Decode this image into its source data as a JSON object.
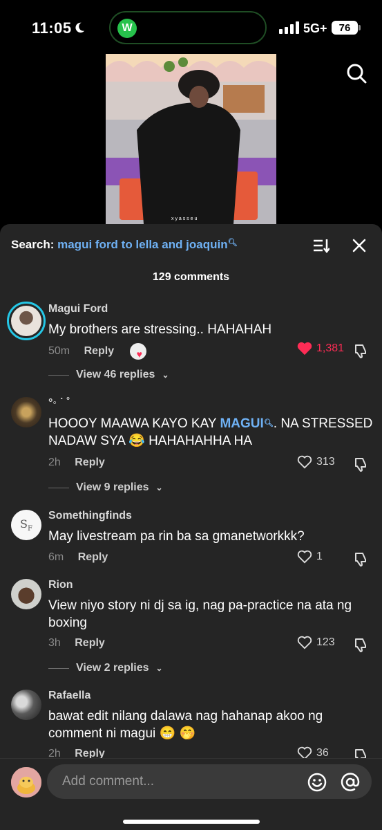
{
  "status_bar": {
    "time": "11:05",
    "network": "5G+",
    "battery": "76",
    "app_badge": "W"
  },
  "video": {
    "watermark": "x y a s s e u"
  },
  "sheet": {
    "search_label": "Search:",
    "search_query": "magui ford to lella and joaquin",
    "comment_count": "129 comments",
    "comments": [
      {
        "author": "Magui Ford",
        "text": "My brothers are stressing.. HAHAHAH",
        "time": "50m",
        "reply_label": "Reply",
        "likes": "1,381",
        "liked": true,
        "view_replies": "View 46 replies"
      },
      {
        "author": "°◦ ˙ ˚",
        "text_before": "HOOOY MAAWA KAYO KAY ",
        "mention": "MAGUI",
        "text_after": ". NA STRESSED NADAW SYA 😂 HAHAHAHHA HA",
        "time": "2h",
        "reply_label": "Reply",
        "likes": "313",
        "view_replies": "View 9 replies"
      },
      {
        "author": "Somethingfinds",
        "text": "May livestream pa rin ba sa gmanetworkkk?",
        "time": "6m",
        "reply_label": "Reply",
        "likes": "1"
      },
      {
        "author": "Rion",
        "text": "View niyo story ni dj sa ig, nag pa-practice na ata ng boxing",
        "time": "3h",
        "reply_label": "Reply",
        "likes": "123",
        "view_replies": "View 2 replies"
      },
      {
        "author": "Rafaella",
        "text": "bawat edit nilang dalawa nag hahanap akoo ng comment ni magui 😁 🤭",
        "time": "2h",
        "reply_label": "Reply",
        "likes": "36"
      }
    ],
    "input_placeholder": "Add comment..."
  },
  "colors": {
    "sheet_bg": "#252525",
    "accent_link": "#6fb1f4",
    "like_red": "#fe2c55"
  }
}
